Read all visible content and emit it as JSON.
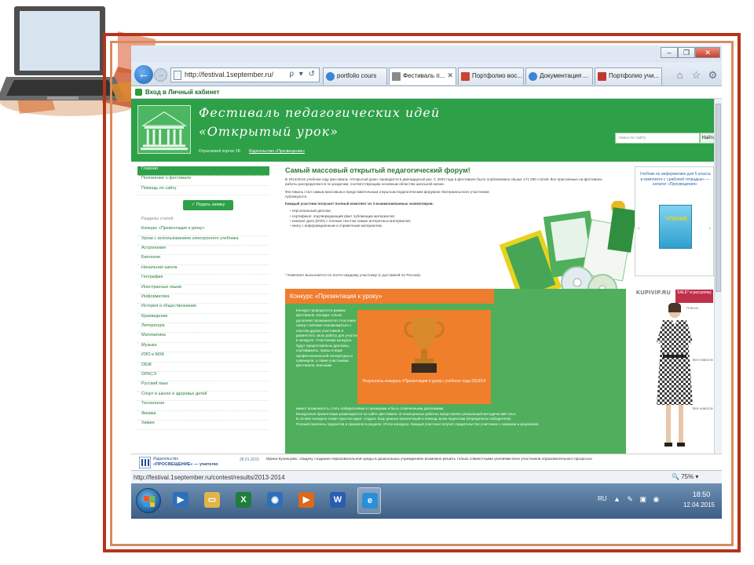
{
  "browser": {
    "window_buttons": [
      "–",
      "❐",
      "✕"
    ],
    "address": "http://festival.1september.ru/",
    "address_tools": "ρ ▾ ↺",
    "tabs": [
      {
        "label": "portfolio cours",
        "icon_color": "#3a86d8",
        "active": false
      },
      {
        "label": "Фестиваль п...",
        "icon_color": "#8a8a8a",
        "active": true
      },
      {
        "label": "Портфолио вос...",
        "icon_color": "#c94431",
        "active": false
      },
      {
        "label": "Документация ...",
        "icon_color": "#3a86d8",
        "active": false
      },
      {
        "label": "Портфолио учи...",
        "icon_color": "#c0392b",
        "active": false
      }
    ],
    "nav_icons": [
      "home-icon",
      "star-icon",
      "gear-icon"
    ],
    "favorites": "Вход в Личный кабинет",
    "status_url": "http://festival.1september.ru/contest/results/2013-2014",
    "zoom": "75%"
  },
  "site": {
    "title_line1": "Фестиваль педагогических идей",
    "title_line2": "«Открытый урок»",
    "sub1": "Отраслевой портал 1Б",
    "sub2": "Издательство «Просвещение»",
    "search_placeholder": "поиск по сайту",
    "search_button": "Найти"
  },
  "leftbar": {
    "top_items": [
      "Главная",
      "Положение о фестивале",
      "Помощь по сайту"
    ],
    "submit_button": "✓ Подать заявку",
    "section_head": "Разделы статей",
    "items": [
      "Конкурс «Презентация к уроку»",
      "Уроки с использованием электронного учебника",
      "Астрономия",
      "Биология",
      "Начальная школа",
      "География",
      "Иностранные языки",
      "Информатика",
      "История и обществознание",
      "Краеведение",
      "Литература",
      "Математика",
      "Музыка",
      "ИЗО и МХК",
      "ОБЖ",
      "ОРКСЭ",
      "Русский язык",
      "Спорт в школе и здоровье детей",
      "Технология",
      "Физика",
      "Химия"
    ]
  },
  "main": {
    "title": "Самый массовый открытый педагогический форум!",
    "p1": "В 2014/2015 учебном году фестиваль «Открытый урок» проводится в двенадцатый раз. С 2003 года в фестивале было опубликовано свыше 171 000 статей. Все присланные на фестиваль работы распределяются по разделам, соответствующим основным областям школьной жизни.",
    "p2": "Фестиваль стал самым массовым и представительным открытым педагогическим форумом. Материалы всех участников публикуются.",
    "p3": "Каждый участник получает полный комплект из 3 взаимосвязанных экземпляров:",
    "list": [
      "персональный диплом;",
      "сертификат, подтверждающий факт публикации материалов;",
      "компакт-диск (DVD) с полным текстом самых интересных материалов;",
      "книгу с информационным и справочным материалом."
    ],
    "footnote": "* Комплект высылается по почте каждому участнику (с доставкой по России)."
  },
  "contest": {
    "head": "Конкурс «Презентация к уроку»",
    "text": "Конкурс проводится в рамках фестиваля. Конкурс только дополняет возможности! Участники смогут поближе познакомиться с опытом других участников и разместить свою работу для участия в конкурсе. Участникам конкурса будут предоставлены дипломы, сертификаты, призы в виде профессиональной литературы и сувениров, а также участникам фестиваля, внесшим",
    "card_caption": "Результаты конкурса «Презентация к уроку» учебного года 2013/14",
    "bottom1": "имеют возможность стать победителями и призерами и быть отмеченными дипломами.",
    "bottom2": "Конкурсные презентации размещаются на сайте фестиваля. В помещенных работах представлен уникальный методический опыт.",
    "bottom3": "В основе конкурса лежит простая идея: создать базу данных презентаций в помощь всем педагогам (Определены победители).",
    "bottom4": "Полный перечень лауреатов и призеров в разделе: Итоги конкурса. Каждый участник получит свидетельство участника с номером и рецензией."
  },
  "ads": {
    "ad1_text": "Учебник по информатике для 5 класса в комплекте с «рабочей тетрадью» — каталог «Просвещения»",
    "ad1_book": "ЧТЕНИЕ",
    "ad1_arrows": [
      "‹",
      "›"
    ],
    "ad2_brand": "KUPIVIP.RU",
    "ad2_sale": "SALE* в рассрочку",
    "ad2_label": "Платье",
    "ad2_more": [
      "Все новости",
      "Все новости"
    ]
  },
  "banner": {
    "logo_line1": "Издательство",
    "logo_line2": "«ПРОСВЕЩЕНИЕ» — учителю",
    "date": "28.01.2015",
    "text1": "Ирина Кузнецова: «Задачу создания образовательной среды в дошкольных учреждениях возможно решить только совместными усилиями всех участников образовательного процесса»",
    "text2": ""
  },
  "taskbar": {
    "apps": [
      {
        "name": "media-player-icon",
        "color": "#2f6fb7",
        "glyph": "▶"
      },
      {
        "name": "folder-icon",
        "color": "#e0b54a",
        "glyph": "▭"
      },
      {
        "name": "excel-icon",
        "color": "#1e7d3b",
        "glyph": "X"
      },
      {
        "name": "volume-icon",
        "color": "#2f6fb7",
        "glyph": "◉"
      },
      {
        "name": "presentation-icon",
        "color": "#d86a1e",
        "glyph": "▶"
      },
      {
        "name": "word-icon",
        "color": "#2a5db0",
        "glyph": "W"
      },
      {
        "name": "ie-icon",
        "color": "#2a8fd8",
        "glyph": "e"
      }
    ],
    "lang": "RU",
    "tray_icons": "▲ ✎ ▣ ◉",
    "time": "18:50",
    "date": "12.04.2015"
  }
}
